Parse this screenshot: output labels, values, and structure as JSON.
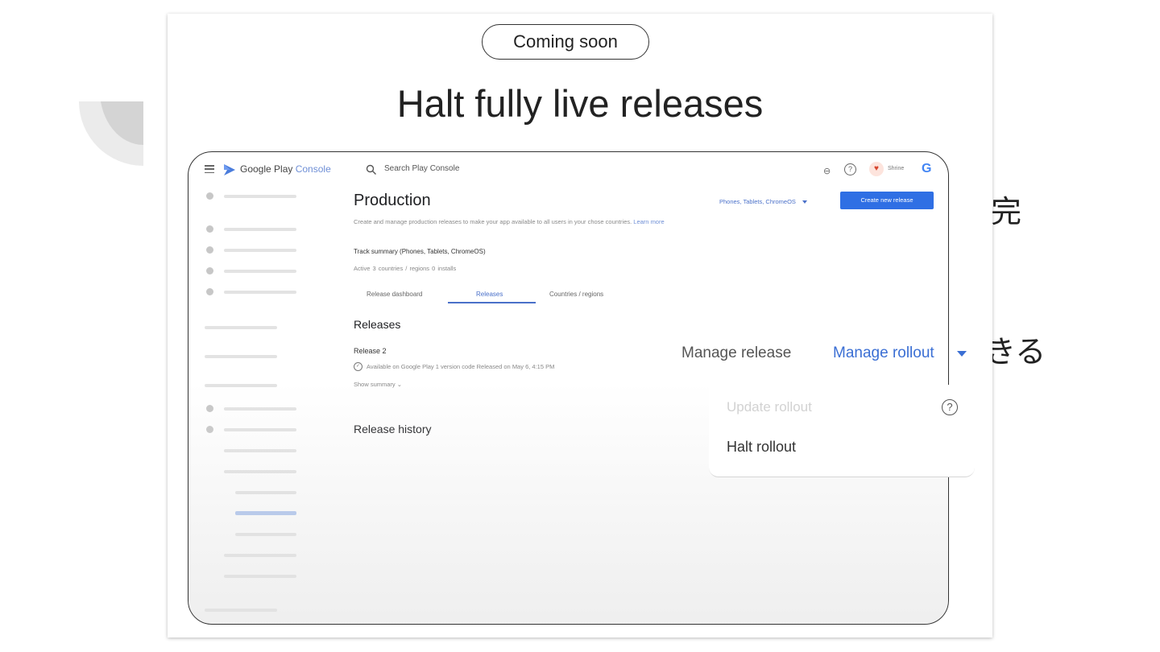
{
  "background": {
    "jp_text_1": "完",
    "jp_text_2": "きる"
  },
  "slide": {
    "badge": "Coming soon",
    "headline": "Halt fully live releases"
  },
  "console": {
    "brand_main": "Google Play",
    "brand_accent": "Console",
    "search_placeholder": "Search Play Console",
    "link_icon_glyph": "⊖",
    "help_glyph": "?",
    "avatar_glyph": "♥",
    "user_name": "Shrine",
    "google_glyph": "G",
    "page_title": "Production",
    "page_description": "Create and manage production releases to make your app available to all users in your chose countries.",
    "learn_more": "Learn more",
    "device_filter": "Phones, Tablets, ChromeOS",
    "create_button": "Create new release",
    "track_summary_title": "Track summary (Phones, Tablets, ChromeOS)",
    "track_summary_meta": "Active   3 countries / regions   0 installs",
    "tabs": [
      {
        "label": "Release dashboard"
      },
      {
        "label": "Releases"
      },
      {
        "label": "Countries / regions"
      }
    ],
    "active_tab": "Releases",
    "releases_heading": "Releases",
    "release": {
      "name": "Release 2",
      "meta": "Available on Google Play    1 version code    Released on May 6, 4:15 PM",
      "show_summary": "Show summary  ⌄"
    },
    "release_history_heading": "Release history"
  },
  "overlay": {
    "manage_release": "Manage release",
    "manage_rollout": "Manage rollout",
    "menu": {
      "update_rollout": "Update rollout",
      "help_glyph": "?",
      "halt_rollout": "Halt rollout"
    }
  },
  "colors": {
    "accent_blue": "#3b6fd4",
    "button_blue": "#2f6fe4",
    "logo_blue": "#6f8fd6"
  }
}
